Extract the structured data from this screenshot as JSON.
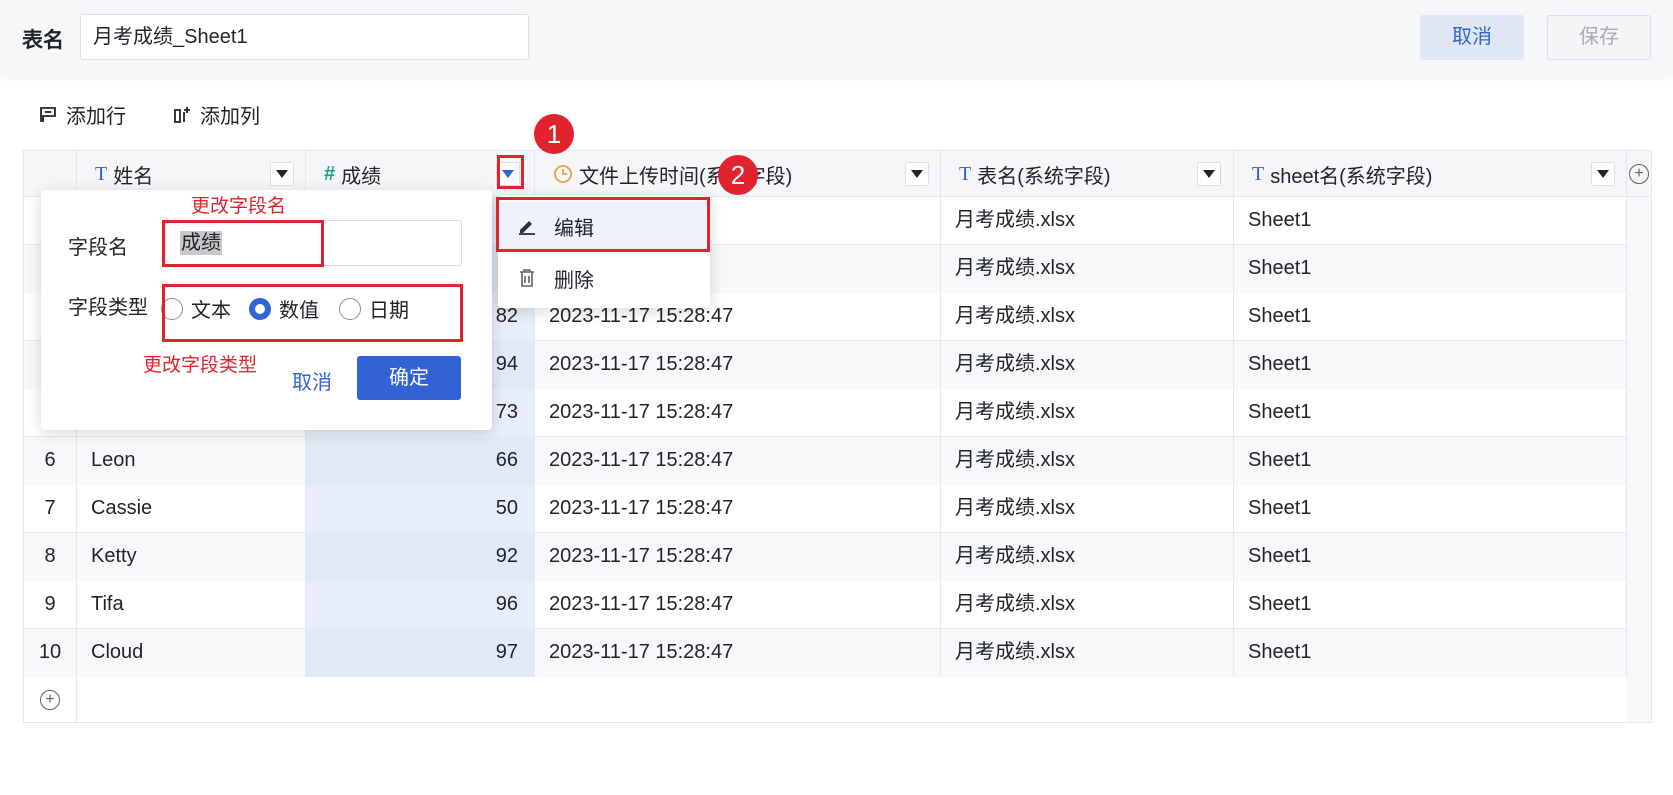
{
  "header": {
    "table_name_label": "表名",
    "table_name_value": "月考成绩_Sheet1",
    "cancel_label": "取消",
    "save_label": "保存"
  },
  "toolbar": {
    "add_row_label": "添加行",
    "add_col_label": "添加列"
  },
  "columns": [
    {
      "type_icon": "T",
      "label": "姓名"
    },
    {
      "type_icon": "#",
      "label": "成绩"
    },
    {
      "type_icon": "clock",
      "label": "文件上传时间(系统字段)"
    },
    {
      "type_icon": "T",
      "label": "表名(系统字段)"
    },
    {
      "type_icon": "T",
      "label": "sheet名(系统字段)"
    }
  ],
  "rows": [
    {
      "idx": "",
      "name": "",
      "score": "",
      "time": "3:47",
      "file": "月考成绩.xlsx",
      "sheet": "Sheet1"
    },
    {
      "idx": "",
      "name": "",
      "score": "",
      "time": "3:47",
      "file": "月考成绩.xlsx",
      "sheet": "Sheet1"
    },
    {
      "idx": "",
      "name": "",
      "score": "82",
      "time": "2023-11-17 15:28:47",
      "file": "月考成绩.xlsx",
      "sheet": "Sheet1"
    },
    {
      "idx": "",
      "name": "",
      "score": "94",
      "time": "2023-11-17 15:28:47",
      "file": "月考成绩.xlsx",
      "sheet": "Sheet1"
    },
    {
      "idx": "",
      "name": "",
      "score": "73",
      "time": "2023-11-17 15:28:47",
      "file": "月考成绩.xlsx",
      "sheet": "Sheet1"
    },
    {
      "idx": "6",
      "name": "Leon",
      "score": "66",
      "time": "2023-11-17 15:28:47",
      "file": "月考成绩.xlsx",
      "sheet": "Sheet1"
    },
    {
      "idx": "7",
      "name": "Cassie",
      "score": "50",
      "time": "2023-11-17 15:28:47",
      "file": "月考成绩.xlsx",
      "sheet": "Sheet1"
    },
    {
      "idx": "8",
      "name": "Ketty",
      "score": "92",
      "time": "2023-11-17 15:28:47",
      "file": "月考成绩.xlsx",
      "sheet": "Sheet1"
    },
    {
      "idx": "9",
      "name": "Tifa",
      "score": "96",
      "time": "2023-11-17 15:28:47",
      "file": "月考成绩.xlsx",
      "sheet": "Sheet1"
    },
    {
      "idx": "10",
      "name": "Cloud",
      "score": "97",
      "time": "2023-11-17 15:28:47",
      "file": "月考成绩.xlsx",
      "sheet": "Sheet1"
    }
  ],
  "edit_panel": {
    "field_name_label": "字段名",
    "field_name_value": "成绩",
    "field_type_label": "字段类型",
    "types": [
      "文本",
      "数值",
      "日期"
    ],
    "selected_type": "数值",
    "cancel_label": "取消",
    "confirm_label": "确定"
  },
  "column_menu": {
    "edit_label": "编辑",
    "delete_label": "删除"
  },
  "annotations": {
    "badge1": "1",
    "badge2": "2",
    "note_rename": "更改字段名",
    "note_retype": "更改字段类型"
  },
  "colors": {
    "accent": "#3262d3",
    "annotation_red": "#e0232d"
  }
}
